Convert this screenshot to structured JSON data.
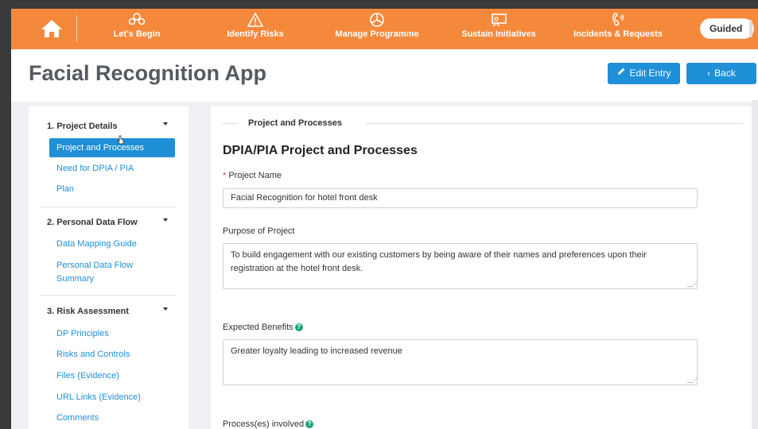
{
  "nav": {
    "items": [
      {
        "label": "Let's Begin",
        "icon": "team-icon"
      },
      {
        "label": "Identify Risks",
        "icon": "warning-icon"
      },
      {
        "label": "Manage Programme",
        "icon": "pie-chart-icon"
      },
      {
        "label": "Sustain Initiatives",
        "icon": "presentation-icon"
      },
      {
        "label": "Incidents & Requests",
        "icon": "phone-icon"
      }
    ],
    "mode_toggle": "Guided"
  },
  "header": {
    "title": "Facial Recognition App",
    "edit_label": "Edit Entry",
    "back_label": "Back"
  },
  "sidebar": {
    "sections": [
      {
        "title": "1. Project Details",
        "items": [
          "Project and Processes",
          "Need for DPIA / PIA",
          "Plan"
        ]
      },
      {
        "title": "2. Personal Data Flow",
        "items": [
          "Data Mapping Guide",
          "Personal Data Flow Summary"
        ]
      },
      {
        "title": "3. Risk Assessment",
        "items": [
          "DP Principles",
          "Risks and Controls",
          "Files (Evidence)",
          "URL Links (Evidence)",
          "Comments"
        ]
      }
    ],
    "active_item": "Project and Processes"
  },
  "main": {
    "legend": "Project and Processes",
    "heading": "DPIA/PIA Project and Processes",
    "fields": {
      "project_name": {
        "label": "Project Name",
        "required_mark": "*",
        "value": "Facial Recognition for hotel front desk"
      },
      "purpose": {
        "label": "Purpose of Project",
        "value": "To build engagement with our existing customers by being aware of their names and preferences upon their registration at the hotel front desk."
      },
      "benefits": {
        "label": "Expected Benefits",
        "value": "Greater loyalty leading to increased revenue"
      },
      "processes": {
        "label": "Process(es) involved"
      }
    },
    "help_glyph": "?"
  },
  "colors": {
    "nav_bg": "#f5893b",
    "primary": "#1f8fd7",
    "help": "#1aa37a",
    "required": "#e23c3c"
  }
}
